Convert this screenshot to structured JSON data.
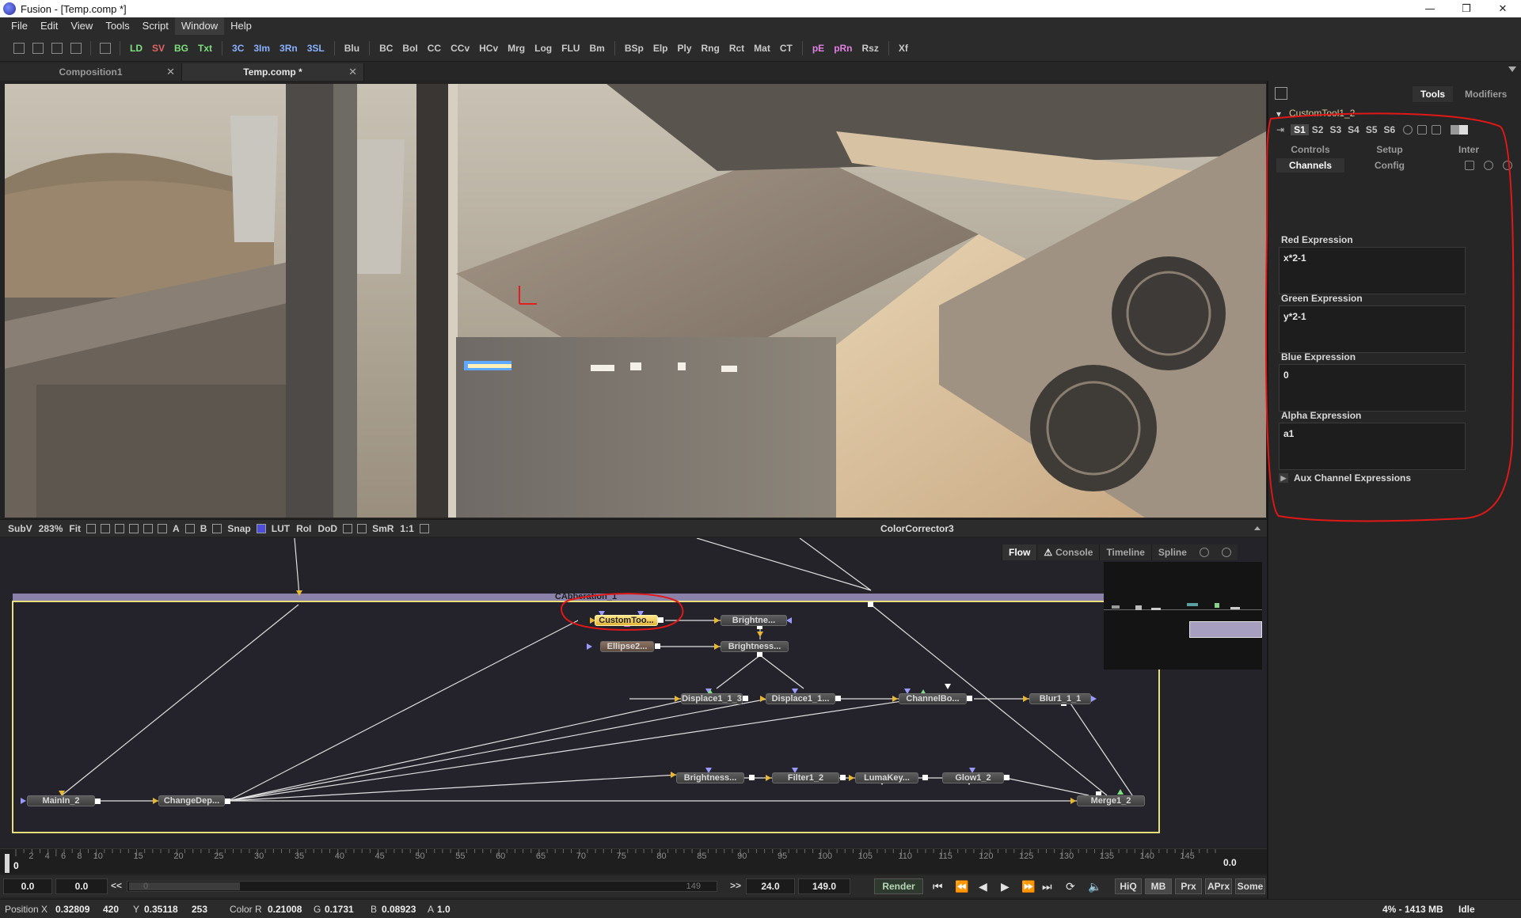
{
  "window": {
    "title": "Fusion - [Temp.comp *]",
    "controls": [
      "—",
      "❒",
      "✕"
    ]
  },
  "menu": [
    "File",
    "Edit",
    "View",
    "Tools",
    "Script",
    "Window",
    "Help"
  ],
  "toolbar": {
    "buttons": [
      {
        "label": "LD",
        "color": "#7fe07f"
      },
      {
        "label": "SV",
        "color": "#e06666"
      },
      {
        "label": "BG",
        "color": "#7fe07f"
      },
      {
        "label": "Txt",
        "color": "#7fe07f"
      },
      {
        "label": "3C",
        "color": "#8ab0ff"
      },
      {
        "label": "3Im",
        "color": "#8ab0ff"
      },
      {
        "label": "3Rn",
        "color": "#8ab0ff"
      },
      {
        "label": "3SL",
        "color": "#8ab0ff"
      },
      {
        "label": "Blu",
        "color": "#c9c9c9"
      },
      {
        "label": "BC",
        "color": "#c9c9c9"
      },
      {
        "label": "BoI",
        "color": "#c9c9c9"
      },
      {
        "label": "CC",
        "color": "#c9c9c9"
      },
      {
        "label": "CCv",
        "color": "#c9c9c9"
      },
      {
        "label": "HCv",
        "color": "#c9c9c9"
      },
      {
        "label": "Mrg",
        "color": "#c9c9c9"
      },
      {
        "label": "Log",
        "color": "#c9c9c9"
      },
      {
        "label": "FLU",
        "color": "#c9c9c9"
      },
      {
        "label": "Bm",
        "color": "#c9c9c9"
      },
      {
        "label": "BSp",
        "color": "#c9c9c9"
      },
      {
        "label": "Elp",
        "color": "#c9c9c9"
      },
      {
        "label": "Ply",
        "color": "#c9c9c9"
      },
      {
        "label": "Rng",
        "color": "#c9c9c9"
      },
      {
        "label": "Rct",
        "color": "#c9c9c9"
      },
      {
        "label": "Mat",
        "color": "#c9c9c9"
      },
      {
        "label": "CT",
        "color": "#c9c9c9"
      },
      {
        "label": "pE",
        "color": "#e080e0"
      },
      {
        "label": "pRn",
        "color": "#e080e0"
      },
      {
        "label": "Rsz",
        "color": "#c9c9c9"
      },
      {
        "label": "Xf",
        "color": "#c9c9c9"
      }
    ]
  },
  "tabs": [
    {
      "label": "Composition1",
      "close": "✕",
      "active": false
    },
    {
      "label": "Temp.comp *",
      "close": "✕",
      "active": true
    }
  ],
  "viewer": {
    "bar": {
      "subv": "SubV",
      "zoom": "283%",
      "fit": "Fit",
      "letters": [
        "A",
        "B"
      ],
      "snap": "Snap",
      "lut": "LUT",
      "roi": "RoI",
      "dod": "DoD",
      "smr": "SmR",
      "ratio": "1:1",
      "title": "ColorCorrector3"
    }
  },
  "flow": {
    "tabs": {
      "flow": "Flow",
      "console": "Console",
      "timeline": "Timeline",
      "spline": "Spline",
      "warn": "⚠"
    },
    "group": "CAbberation_1",
    "nodes": {
      "customtool": "CustomToo...",
      "brightness_a": "Brightne...",
      "ellipse": "Ellipse2...",
      "brightness_b": "Brightness...",
      "displace_a": "Displace1_1_3",
      "displace_b": "Displace1_1...",
      "channelbool": "ChannelBo...",
      "blur": "Blur1_1_1",
      "brightness_c": "Brightness...",
      "filter": "Filter1_2",
      "lumakey": "LumaKey...",
      "glow": "Glow1_2",
      "mainin": "MainIn_2",
      "changedepth": "ChangeDep...",
      "merge": "Merge1_2"
    }
  },
  "timeline": {
    "ruler_labels": [
      "2",
      "4",
      "6",
      "8",
      "10",
      "15",
      "20",
      "25",
      "30",
      "35",
      "40",
      "45",
      "50",
      "55",
      "60",
      "65",
      "70",
      "75",
      "80",
      "85",
      "90",
      "95",
      "100",
      "105",
      "110",
      "115",
      "120",
      "125",
      "130",
      "135",
      "140",
      "145"
    ],
    "current_frame": "0",
    "right_value": "0.0",
    "global_start": "0.0",
    "render_start": "0.0",
    "rewind_label": "<<",
    "slider_start": "0",
    "slider_end": "149",
    "forward_label": ">>",
    "fps": "24.0",
    "render_end": "149.0",
    "render": "Render",
    "toggles": [
      "HiQ",
      "MB",
      "Prx",
      "APrx",
      "Some"
    ]
  },
  "status": {
    "position_x_label": "Position X",
    "position_x": "0.32809",
    "px": "420",
    "position_y_label": "Y",
    "position_y": "0.35118",
    "py": "253",
    "color_r_label": "Color R",
    "color_r": "0.21008",
    "color_g_label": "G",
    "color_g": "0.1731",
    "color_b_label": "B",
    "color_b": "0.08923",
    "alpha_label": "A",
    "alpha": "1.0",
    "memory": "4% - 1413 MB",
    "state": "Idle"
  },
  "inspector": {
    "tabs": {
      "tools": "Tools",
      "modifiers": "Modifiers"
    },
    "tool_name": "CustomTool1_2",
    "slots": [
      "S1",
      "S2",
      "S3",
      "S4",
      "S5",
      "S6"
    ],
    "subtabs_row1": [
      "Controls",
      "Setup",
      "Inter"
    ],
    "subtabs_row2": [
      "Channels",
      "Config"
    ],
    "fields": [
      {
        "label": "Red Expression",
        "value": "x*2-1"
      },
      {
        "label": "Green Expression",
        "value": "y*2-1"
      },
      {
        "label": "Blue Expression",
        "value": "0"
      },
      {
        "label": "Alpha Expression",
        "value": "a1"
      }
    ],
    "aux": "Aux Channel Expressions"
  }
}
